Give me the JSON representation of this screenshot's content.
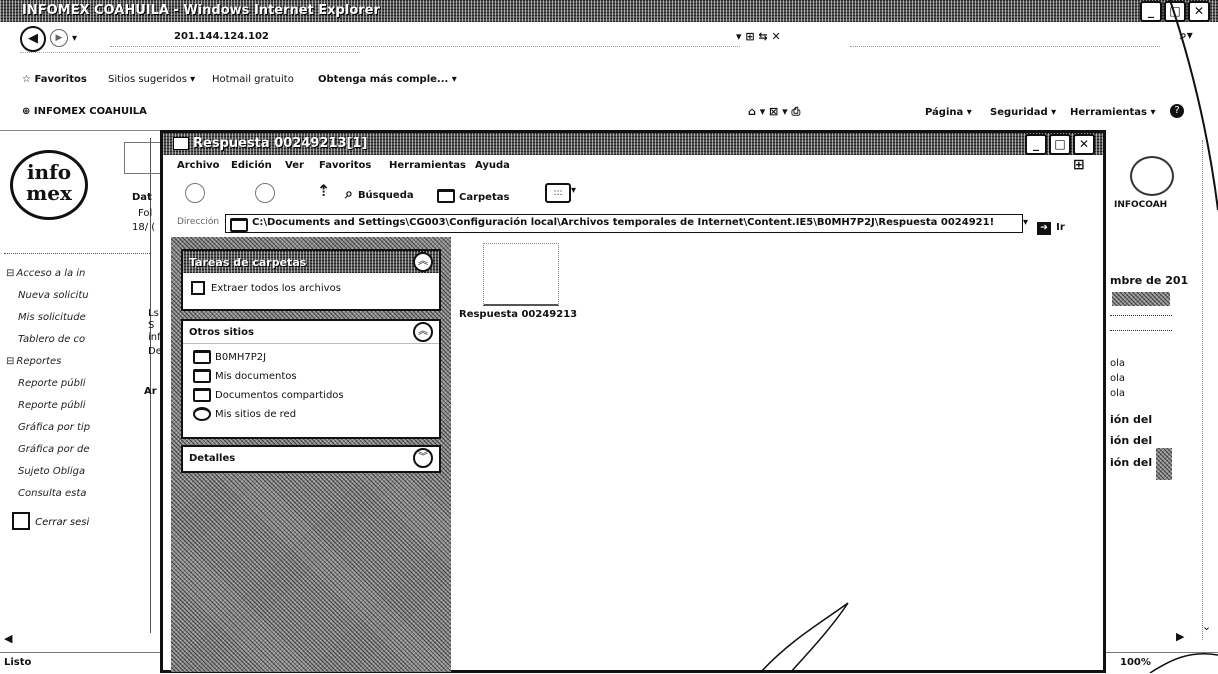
{
  "browser": {
    "title": "INFOMEX COAHUILA - Windows Internet Explorer",
    "address": "201.144.124.102",
    "favorites_label": "Favoritos",
    "links": [
      "Sitios sugeridos ▾",
      "Hotmail gratuito",
      "Obtenga más comple... ▾"
    ],
    "tab_title": "INFOMEX COAHUILA",
    "command_bar": [
      "Página ▾",
      "Seguridad ▾",
      "Herramientas ▾"
    ],
    "status": "Listo",
    "zoom": "100%"
  },
  "page": {
    "logo_top": "info",
    "logo_bottom": "mex",
    "fragments_left": [
      "Dat",
      "Fol",
      "18/ ("
    ],
    "fragments_mid": [
      "Ls",
      "S",
      "inf",
      "De",
      "Ar"
    ],
    "fragments_right": [
      "mbre de 201",
      "ola",
      "ola",
      "ola",
      "ión del",
      "ión del",
      "ión del"
    ],
    "right_brand": "INFOCOAH",
    "nav": [
      {
        "label": "Acceso a la in",
        "indent": false,
        "prefix": "⊟"
      },
      {
        "label": "Nueva solicitu",
        "indent": true
      },
      {
        "label": "Mis solicitude",
        "indent": true
      },
      {
        "label": "Tablero de co",
        "indent": true
      },
      {
        "label": "Reportes",
        "indent": false,
        "prefix": "⊟"
      },
      {
        "label": "Reporte públi",
        "indent": true
      },
      {
        "label": "Reporte públi",
        "indent": true
      },
      {
        "label": "Gráfica por tip",
        "indent": true
      },
      {
        "label": "Gráfica por de",
        "indent": true
      },
      {
        "label": "Sujeto Obliga",
        "indent": true
      },
      {
        "label": "Consulta esta",
        "indent": true
      }
    ],
    "logout": "Cerrar sesi"
  },
  "explorer": {
    "title": "Respuesta 00249213[1]",
    "menu": [
      "Archivo",
      "Edición",
      "Ver",
      "Favoritos",
      "Herramientas",
      "Ayuda"
    ],
    "toolbar": {
      "search": "Búsqueda",
      "folders": "Carpetas"
    },
    "address_label": "Dirección",
    "address": "C:\\Documents and Settings\\CG003\\Configuración local\\Archivos temporales de Internet\\Content.IE5\\B0MH7P2J\\Respuesta 0024921!",
    "go": "Ir",
    "tasks_header": "Tareas de carpetas",
    "tasks": [
      "Extraer todos los archivos"
    ],
    "other_header": "Otros sitios",
    "other_places": [
      "B0MH7P2J",
      "Mis documentos",
      "Documentos compartidos",
      "Mis sitios de red"
    ],
    "details_header": "Detalles",
    "file_label": "Respuesta 00249213"
  }
}
